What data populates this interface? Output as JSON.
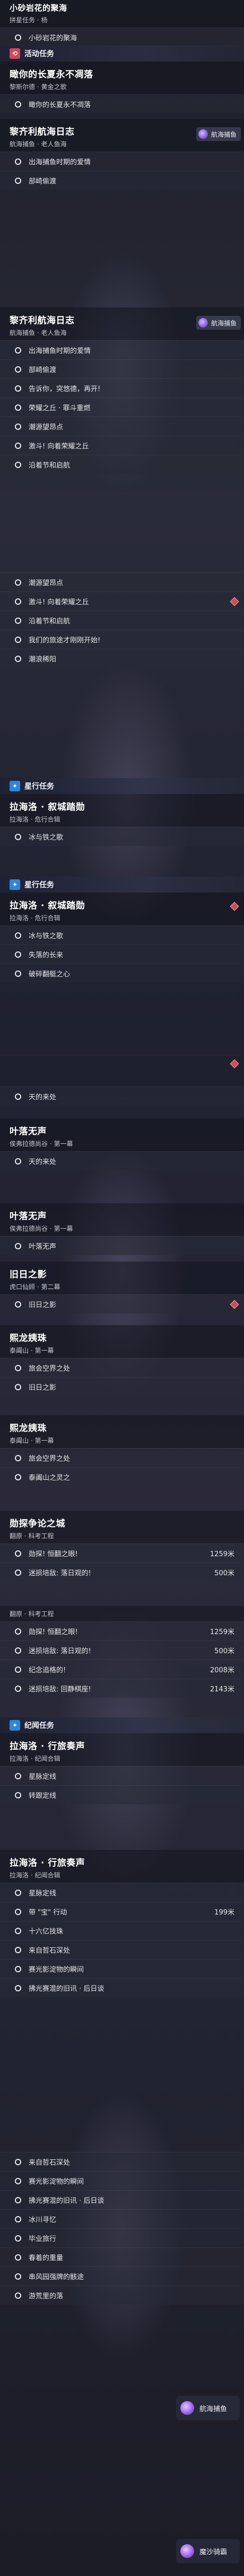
{
  "top": {
    "title": "小砂岩花的聚海",
    "sub": "拼星任务 · 杨",
    "rows": [
      "小砂岩花的聚海"
    ]
  },
  "sections": {
    "huodong": "活动任务",
    "xinghang": "星行任务",
    "jiwen": "纪闻任务"
  },
  "quests": {
    "q1": {
      "title": "瞰你的长夏永不凋落",
      "sub": "黎斯尔德 · 黄金之歌",
      "rows": [
        "瞰你的长夏永不凋落"
      ]
    },
    "q2": {
      "title": "黎齐利航海日志",
      "sub": "航海捕鱼 · 老人鱼海",
      "chip": "航海捕鱼",
      "rows": [
        "出海捕鱼时期的爱情",
        "部崎偷渡"
      ]
    },
    "q3": {
      "title": "黎齐利航海日志",
      "sub": "航海捕鱼 · 老人鱼海",
      "chip": "航海捕鱼",
      "rows": [
        "出海捕鱼时期的爱情",
        "部崎偷渡",
        "告诉你，突悠德，再开!",
        "荣耀之丘 · 罪斗重燃",
        "潮源望昂点",
        "激斗! 向着荣耀之丘",
        "沿着节和启航"
      ],
      "more": [
        "潮源望昂点",
        "激斗! 向着荣耀之丘",
        "沿着节和启航",
        "我们的旅途才刚刚开始!",
        "潮浪稀阳"
      ]
    },
    "q4": {
      "title": "拉海洛 · 叙城踏勋",
      "sub": "拉海洛 · 危行合辑",
      "rows": [
        "冰与铁之歌"
      ]
    },
    "q5": {
      "title": "拉海洛 · 叙城踏勋",
      "sub": "拉海洛 · 危行合辑",
      "rows": [
        "冰与铁之歌",
        "失落的长来",
        "破碎翻艇之心",
        "天的来处"
      ]
    },
    "q6": {
      "title": "叶落无声",
      "sub": "俟弗拉德尚谷 · 第一幕",
      "rows": [
        "天的来处"
      ]
    },
    "q7": {
      "title": "叶落无声",
      "sub": "俟弗拉德尚谷 · 第一幕",
      "rows": [
        "叶落无声"
      ]
    },
    "q8": {
      "title": "旧日之影",
      "sub": "虎口仙顾 · 第二幕",
      "rows": [
        "旧日之影"
      ]
    },
    "q9": {
      "title": "熙龙姨珠",
      "sub": "泰阗山 · 第一幕",
      "rows": [
        "旅会空界之处",
        "旧日之影"
      ]
    },
    "q10": {
      "title": "熙龙姨珠",
      "sub": "泰阗山 · 第一幕",
      "rows": [
        "旅会空界之处",
        "泰阗山之灵之"
      ]
    },
    "q11": {
      "title": "勋探争论之城",
      "sub": "翻原 · 科考工程",
      "rows": [
        {
          "l": "勋探! 恒翻之眼!",
          "v": "1259米"
        },
        {
          "l": "迷损培敌: 落日观的!",
          "v": "500米"
        }
      ]
    },
    "q12": {
      "title": "翻原 · 科考工程",
      "rows": [
        {
          "l": "勋探! 恒翻之眼!",
          "v": "1259米"
        },
        {
          "l": "迷损培敌: 落日观的!",
          "v": "500米"
        },
        {
          "l": "纪念追格的!",
          "v": "2008米"
        },
        {
          "l": "迷损培敌: 回静棋座!",
          "v": "2143米"
        }
      ]
    },
    "q13": {
      "title": "拉海洛 · 行旅奏声",
      "sub": "拉海洛 · 纪闻合辑",
      "rows": [
        "星脉定线",
        "转跟定线"
      ]
    },
    "q14": {
      "title": "拉海洛 · 行旅奏声",
      "sub": "拉海洛 · 纪闻合辑",
      "rows": [
        {
          "l": "星脉定线",
          "v": ""
        },
        {
          "l": "带 \"宝\" 行动",
          "v": "199米"
        },
        {
          "l": "十六亿技珠",
          "v": ""
        },
        {
          "l": "来自哲石深处",
          "v": ""
        },
        {
          "l": "赛光影淀物的瞬间",
          "v": ""
        },
        {
          "l": "拂光赛混的旧讯 · 后日谈",
          "v": ""
        }
      ]
    },
    "q15": {
      "rows": [
        "来自哲石深处",
        "赛光影淀物的瞬间",
        "拂光赛混的旧讯 · 后日谈",
        "冰川寻忆",
        "毕业旅行",
        "春着的重量",
        "串风园强牌的骸途",
        "游荒里的落"
      ]
    }
  },
  "chips": {
    "hotbar": "航海捕鱼",
    "bottom": "魔沙骑霸"
  }
}
